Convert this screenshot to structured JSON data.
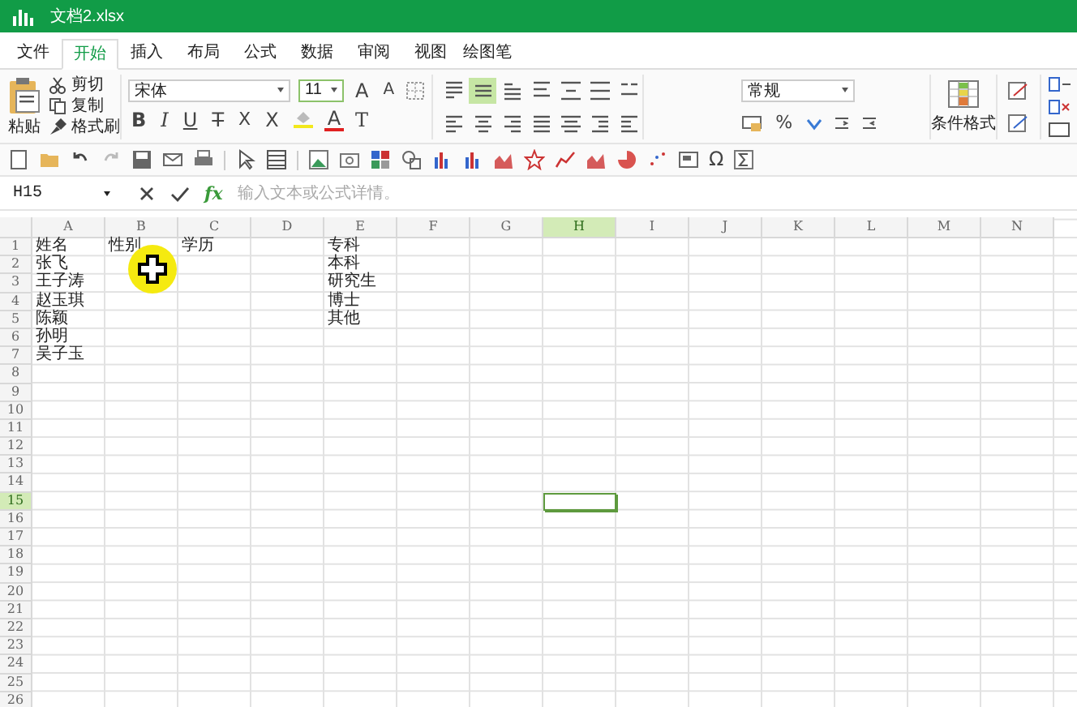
{
  "window": {
    "title": "文档2.xlsx"
  },
  "tabs": [
    {
      "label": "文件",
      "selected": false
    },
    {
      "label": "开始",
      "selected": true
    },
    {
      "label": "插入",
      "selected": false
    },
    {
      "label": "布局",
      "selected": false
    },
    {
      "label": "公式",
      "selected": false
    },
    {
      "label": "数据",
      "selected": false
    },
    {
      "label": "审阅",
      "selected": false
    },
    {
      "label": "视图",
      "selected": false
    },
    {
      "label": "绘图笔",
      "selected": false
    }
  ],
  "ribbon": {
    "clipboard": {
      "paste": "粘贴",
      "items": [
        {
          "kind": "cut",
          "label": "剪切"
        },
        {
          "kind": "copy",
          "label": "复制"
        },
        {
          "kind": "painter",
          "label": "格式刷"
        }
      ]
    },
    "font": {
      "name": "宋体",
      "size": "11",
      "top_buttons": [
        {
          "kind": "grow",
          "label": "A"
        },
        {
          "kind": "shrink",
          "label": "A"
        }
      ],
      "bottom_buttons": [
        {
          "kind": "bold",
          "label": "B"
        },
        {
          "kind": "italic",
          "label": "I"
        },
        {
          "kind": "underline",
          "label": "U"
        },
        {
          "kind": "strike",
          "label": "T"
        },
        {
          "kind": "subscript",
          "label": "X"
        },
        {
          "kind": "superscript",
          "label": "X"
        },
        {
          "kind": "fill"
        },
        {
          "kind": "color",
          "label": "A"
        },
        {
          "kind": "clear",
          "label": "T"
        }
      ]
    },
    "alignment": [
      {
        "kind": "top",
        "selected": false
      },
      {
        "kind": "middle",
        "selected": true
      },
      {
        "kind": "bottom",
        "selected": false
      },
      {
        "kind": "wrap",
        "selected": false
      },
      {
        "kind": "merge",
        "selected": false
      },
      {
        "kind": "merge-menu",
        "selected": false
      },
      {
        "kind": "orient",
        "selected": false
      },
      {
        "kind": "left",
        "selected": false
      },
      {
        "kind": "center",
        "selected": false
      },
      {
        "kind": "right",
        "selected": false
      },
      {
        "kind": "justify",
        "selected": false
      },
      {
        "kind": "distributed",
        "selected": false
      },
      {
        "kind": "indent-dec",
        "selected": false
      },
      {
        "kind": "indent-inc",
        "selected": false
      }
    ],
    "number": {
      "format": "常规",
      "percent": "%"
    },
    "styles": {
      "conditional_format": "条件格式"
    }
  },
  "quick_toolbar": {
    "symbol": "Ω"
  },
  "formula_bar": {
    "name_box": "H15",
    "fx": "fx",
    "placeholder": "输入文本或公式详情。"
  },
  "sheet": {
    "columns": [
      {
        "label": "A",
        "selected": false
      },
      {
        "label": "B",
        "selected": false
      },
      {
        "label": "C",
        "selected": false
      },
      {
        "label": "D",
        "selected": false
      },
      {
        "label": "E",
        "selected": false
      },
      {
        "label": "F",
        "selected": false
      },
      {
        "label": "G",
        "selected": false
      },
      {
        "label": "H",
        "selected": true
      },
      {
        "label": "I",
        "selected": false
      },
      {
        "label": "J",
        "selected": false
      },
      {
        "label": "K",
        "selected": false
      },
      {
        "label": "L",
        "selected": false
      },
      {
        "label": "M",
        "selected": false
      },
      {
        "label": "N",
        "selected": false
      }
    ],
    "rows": [
      {
        "label": "1",
        "selected": false,
        "cells": {
          "A": "姓名",
          "B": "性别",
          "C": "学历",
          "E": "专科"
        }
      },
      {
        "label": "2",
        "selected": false,
        "cells": {
          "A": "张飞",
          "E": "本科"
        }
      },
      {
        "label": "3",
        "selected": false,
        "cells": {
          "A": "王子涛",
          "E": "研究生"
        }
      },
      {
        "label": "4",
        "selected": false,
        "cells": {
          "A": "赵玉琪",
          "E": "博士"
        }
      },
      {
        "label": "5",
        "selected": false,
        "cells": {
          "A": "陈颖",
          "E": "其他"
        }
      },
      {
        "label": "6",
        "selected": false,
        "cells": {
          "A": "孙明"
        }
      },
      {
        "label": "7",
        "selected": false,
        "cells": {
          "A": "吴子玉"
        }
      },
      {
        "label": "8",
        "selected": false
      },
      {
        "label": "9",
        "selected": false
      },
      {
        "label": "10",
        "selected": false
      },
      {
        "label": "11",
        "selected": false
      },
      {
        "label": "12",
        "selected": false
      },
      {
        "label": "13",
        "selected": false
      },
      {
        "label": "14",
        "selected": false
      },
      {
        "label": "15",
        "selected": true
      },
      {
        "label": "16",
        "selected": false
      },
      {
        "label": "17",
        "selected": false
      },
      {
        "label": "18",
        "selected": false
      },
      {
        "label": "19",
        "selected": false
      },
      {
        "label": "20",
        "selected": false
      },
      {
        "label": "21",
        "selected": false
      },
      {
        "label": "22",
        "selected": false
      },
      {
        "label": "23",
        "selected": false
      },
      {
        "label": "24",
        "selected": false
      },
      {
        "label": "25",
        "selected": false
      },
      {
        "label": "26",
        "selected": false
      }
    ]
  }
}
